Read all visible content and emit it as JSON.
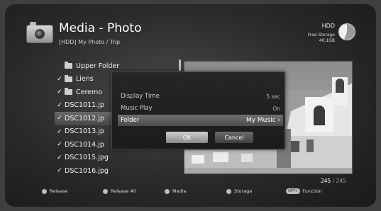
{
  "header": {
    "title": "Media - Photo",
    "path": "[HDD]  My Photo / Trip",
    "hdd_label": "HDD",
    "storage_label": "Free Storage",
    "storage_value": "40.1GB"
  },
  "file_list": {
    "items": [
      {
        "name": "Upper Folder",
        "checked": false,
        "type": "folder-up"
      },
      {
        "name": "Liens",
        "checked": true,
        "type": "folder"
      },
      {
        "name": "Ceremo",
        "checked": true,
        "type": "folder"
      },
      {
        "name": "DSC1011.jp",
        "checked": true,
        "type": "file"
      },
      {
        "name": "DSC1012.jp",
        "checked": true,
        "type": "file"
      },
      {
        "name": "DSC1013.jp",
        "checked": true,
        "type": "file"
      },
      {
        "name": "DSC1014.jp",
        "checked": true,
        "type": "file"
      },
      {
        "name": "DSC1015.jpg",
        "checked": true,
        "type": "file"
      },
      {
        "name": "DSC1016.jpg",
        "checked": true,
        "type": "file"
      }
    ],
    "selected_index": 4,
    "check_glyph": "✓"
  },
  "dialog": {
    "rows": [
      {
        "label": "Display Time",
        "value": "5 sec"
      },
      {
        "label": "Music Play",
        "value": "On"
      },
      {
        "label": "Folder",
        "value": "My Music"
      }
    ],
    "active_index": 2,
    "arrow_glyph": "›",
    "ok_label": "OK",
    "cancel_label": "Cancel"
  },
  "counter": {
    "current": "245",
    "separator": " / ",
    "total": "245"
  },
  "footer": {
    "items": [
      {
        "label": "Release",
        "icon": "dot-button-icon"
      },
      {
        "label": "Release All",
        "icon": "dot-button-icon"
      },
      {
        "label": "Media",
        "icon": "dot-button-icon"
      },
      {
        "label": "Storage",
        "icon": "dot-button-icon"
      },
      {
        "label": "Function",
        "icon": "opt-button-icon",
        "key": "OPT+"
      }
    ]
  },
  "colors": {
    "background": "#2a2a2a",
    "highlight": "#5c5c5c",
    "text": "#eaeaea"
  }
}
